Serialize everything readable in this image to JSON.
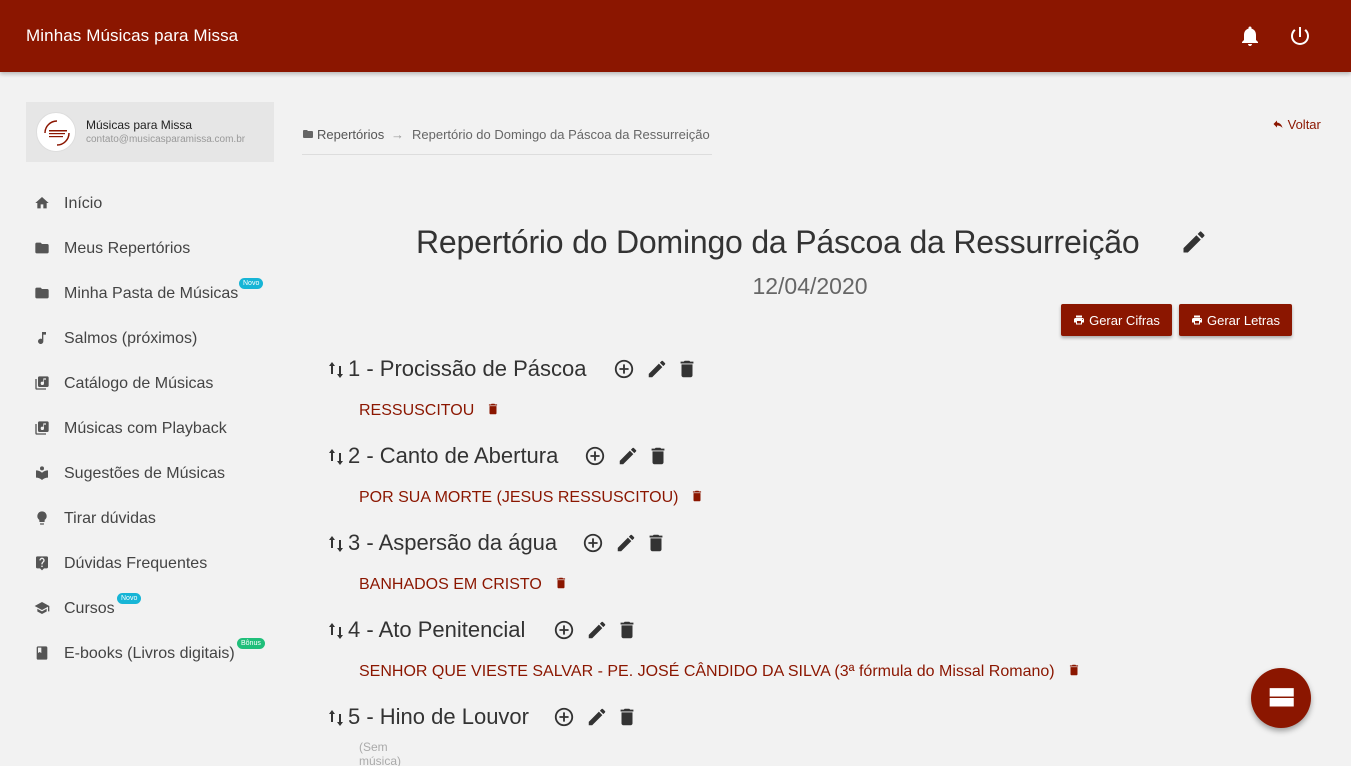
{
  "header": {
    "title": "Minhas Músicas para Missa"
  },
  "profile": {
    "name": "Músicas para Missa",
    "email": "contato@musicasparamissa.com.br"
  },
  "sidebar": {
    "items": [
      {
        "label": "Início",
        "icon": "home-icon"
      },
      {
        "label": "Meus Repertórios",
        "icon": "folder-icon"
      },
      {
        "label": "Minha Pasta de Músicas",
        "icon": "folder-icon",
        "badge": "Novo"
      },
      {
        "label": "Salmos (próximos)",
        "icon": "music-note-icon"
      },
      {
        "label": "Catálogo de Músicas",
        "icon": "library-music-icon"
      },
      {
        "label": "Músicas com Playback",
        "icon": "library-music-icon"
      },
      {
        "label": "Sugestões de Músicas",
        "icon": "book-open-icon"
      },
      {
        "label": "Tirar dúvidas",
        "icon": "lightbulb-icon"
      },
      {
        "label": "Dúvidas Frequentes",
        "icon": "help-icon"
      },
      {
        "label": "Cursos",
        "icon": "school-icon",
        "badge": "Novo"
      },
      {
        "label": "E-books (Livros digitais)",
        "icon": "book-icon",
        "badge": "Bônus"
      }
    ]
  },
  "breadcrumb": {
    "root": "Repertórios",
    "arrow": "→",
    "current": "Repertório do Domingo da Páscoa da Ressurreição"
  },
  "back_label": "Voltar",
  "repertoire": {
    "title": "Repertório do Domingo da Páscoa da Ressurreição",
    "date": "12/04/2020"
  },
  "buttons": {
    "cifras": "Gerar Cifras",
    "letras": "Gerar Letras"
  },
  "sections": [
    {
      "title": "1 - Procissão de Páscoa",
      "song": "RESSUSCITOU"
    },
    {
      "title": "2 - Canto de Abertura",
      "song": "POR SUA MORTE (JESUS RESSUSCITOU)"
    },
    {
      "title": "3 - Aspersão da água",
      "song": "BANHADOS EM CRISTO"
    },
    {
      "title": "4 - Ato Penitencial",
      "song": "SENHOR QUE VIESTE SALVAR - PE. JOSÉ CÂNDIDO DA SILVA (3ª fórmula do Missal Romano)"
    },
    {
      "title": "5 - Hino de Louvor",
      "empty_label": "(Sem música)"
    }
  ],
  "colors": {
    "primary": "#8b1600",
    "badge_new": "#17b5d6",
    "badge_bonus": "#1fbf7a"
  }
}
